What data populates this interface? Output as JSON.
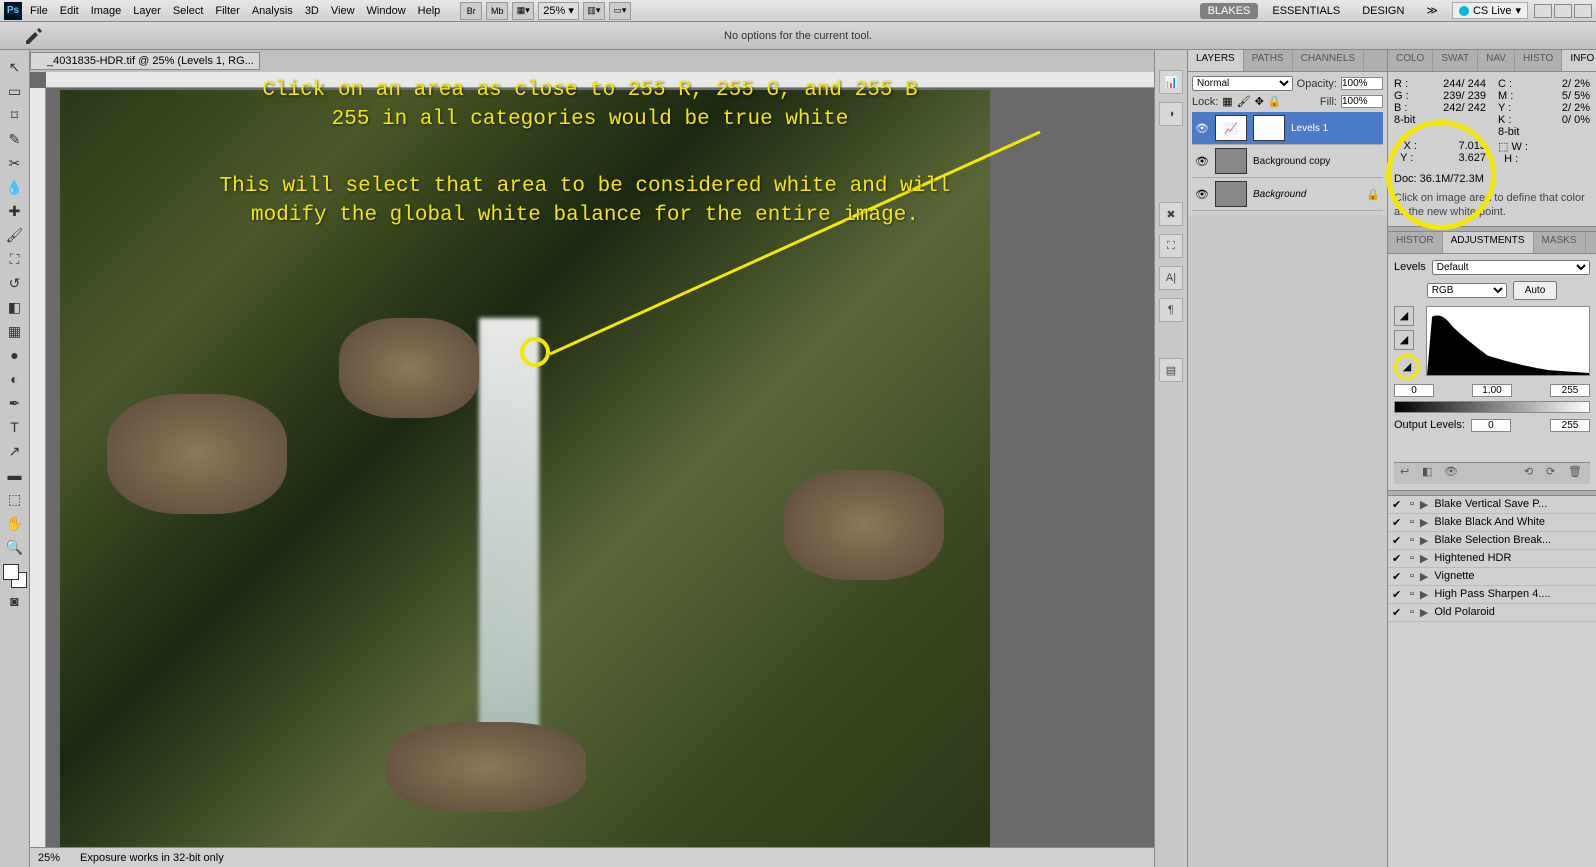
{
  "menu": [
    "File",
    "Edit",
    "Image",
    "Layer",
    "Select",
    "Filter",
    "Analysis",
    "3D",
    "View",
    "Window",
    "Help"
  ],
  "zoom": "25%",
  "workspaces": {
    "active": "BLAKES",
    "items": [
      "BLAKES",
      "ESSENTIALS",
      "DESIGN"
    ]
  },
  "cslive": "CS Live",
  "options_msg": "No options for the current tool.",
  "doc_tab": "_4031835-HDR.tif @ 25% (Levels 1, RG...",
  "annot1": "Click on an area as close to 255 R, 255 G, and 255 B\n255 in all categories would be true white",
  "annot2": "This will select that area to be considered white and will\nmodify the global white balance for the entire image.",
  "status": {
    "zoom": "25%",
    "msg": "Exposure works in 32-bit only"
  },
  "layers_panel": {
    "tabs": [
      "LAYERS",
      "PATHS",
      "CHANNELS"
    ],
    "blend": "Normal",
    "opacity_lbl": "Opacity:",
    "opacity": "100%",
    "lock_lbl": "Lock:",
    "fill_lbl": "Fill:",
    "fill": "100%",
    "items": [
      {
        "name": "Levels 1",
        "sel": true,
        "adj": true
      },
      {
        "name": "Background copy"
      },
      {
        "name": "Background",
        "locked": true,
        "italic": true
      }
    ]
  },
  "info_panel": {
    "tabs": [
      "COLO",
      "SWAT",
      "NAV",
      "HISTO",
      "INFO"
    ],
    "rgb": {
      "R": "244/ 244",
      "G": "239/ 239",
      "B": "242/ 242"
    },
    "cmyk": {
      "C": "2/ 2%",
      "M": "5/ 5%",
      "Y": "2/ 2%",
      "K": "0/ 0%"
    },
    "mode": "8-bit",
    "mode2": "8-bit",
    "xy": {
      "X": "7.013",
      "Y": "3.627"
    },
    "wh": {
      "W": "",
      "H": ""
    },
    "doc": "Doc: 36.1M/72.3M",
    "hint": "Click on image area to define that color as the new white point."
  },
  "adj_panel": {
    "tabs": [
      "HISTOR",
      "ADJUSTMENTS",
      "MASKS"
    ],
    "type": "Levels",
    "preset": "Default",
    "channel": "RGB",
    "auto": "Auto",
    "in": [
      "0",
      "1.00",
      "255"
    ],
    "out_lbl": "Output Levels:",
    "out": [
      "0",
      "255"
    ]
  },
  "actions": [
    "Blake Vertical Save P...",
    "Blake Black And White",
    "Blake Selection Break...",
    "Hightened HDR",
    "Vignette",
    "High Pass Sharpen 4....",
    "Old Polaroid"
  ]
}
